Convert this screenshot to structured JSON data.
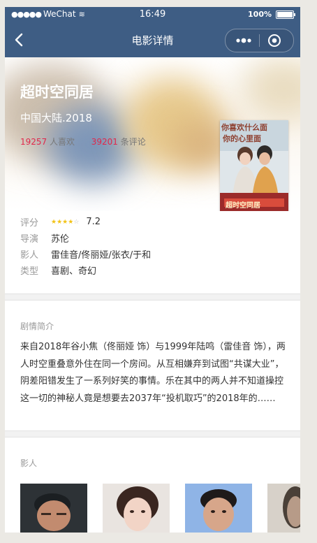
{
  "status_bar": {
    "signal": "●●●●●",
    "carrier": "WeChat",
    "wifi": "≋",
    "time": "16:49",
    "battery": "100%"
  },
  "nav": {
    "title": "电影详情",
    "back_icon": "chevron-left-icon",
    "more_icon": "more-dots-icon",
    "close_icon": "target-close-icon",
    "color": "#3e5d84"
  },
  "movie": {
    "title": "超时空同居",
    "region_year": "中国大陆.2018",
    "likes": "19257",
    "likes_label": "人喜欢",
    "comments": "39201",
    "comments_label": "条评论",
    "poster_text_top": "你喜欢什么面",
    "poster_text_top2": "你的心里面",
    "poster_title": "超时空同居"
  },
  "info": {
    "rating_label": "评分",
    "rating_value": "7.2",
    "rating_stars": 4,
    "director_label": "导演",
    "director": "苏伦",
    "cast_label": "影人",
    "cast": "雷佳音/佟丽娅/张衣/于和",
    "genre_label": "类型",
    "genre": "喜剧、奇幻"
  },
  "summary": {
    "title": "剧情简介",
    "text": "来自2018年谷小焦（佟丽娅 饰）与1999年陆鸣（雷佳音 饰），两人时空重叠意外住在同一个房间。从互相嫌弃到试图“共谋大业”，阴差阳错发生了一系列好笑的事情。乐在其中的两人并不知道操控这一切的神秘人竟是想要去2037年“投机取巧”的2018年的……"
  },
  "cast_section": {
    "title": "影人"
  },
  "colors": {
    "accent_red": "#e0284b",
    "star_yellow": "#f2c316"
  }
}
